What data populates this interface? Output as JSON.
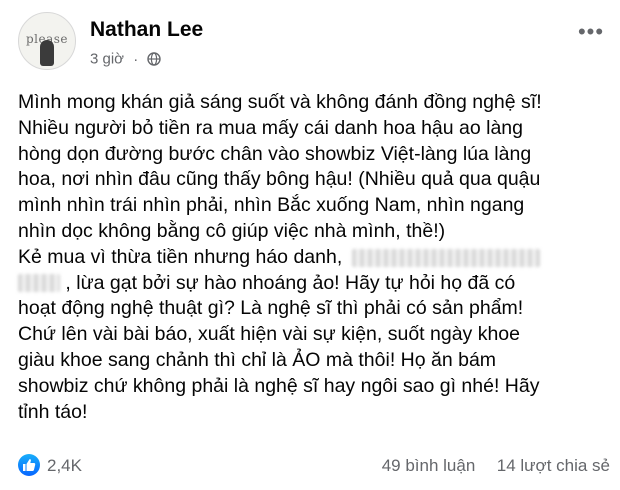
{
  "author": {
    "name": "Nathan Lee",
    "avatar_text": "please"
  },
  "meta": {
    "time": "3 giờ",
    "separator": "·",
    "audience_icon": "globe-icon",
    "more_icon": "more-dots-icon"
  },
  "post": {
    "lines": [
      "Mình mong khán giả sáng suốt và không đánh đồng nghệ sĩ!",
      "Nhiều người bỏ tiền ra mua mấy cái danh hoa hậu ao làng",
      "hòng dọn đường bước chân vào showbiz Việt-làng lúa làng",
      "hoa, nơi nhìn đâu cũng thấy bông hậu! (Nhiều quả qua quậu",
      "mình nhìn trái nhìn phải, nhìn Bắc xuống Nam, nhìn ngang",
      "nhìn dọc không bằng cô giúp việc nhà mình, thề!)",
      "Kẻ mua vì thừa tiền nhưng háo danh,",
      ", lừa gạt bởi sự hào nhoáng ảo! Hãy tự hỏi họ đã có",
      "hoạt động nghệ thuật gì? Là nghệ sĩ thì phải có sản phẩm!",
      "Chứ lên vài bài báo, xuất hiện vài sự kiện, suốt ngày khoe",
      "giàu khoe sang chảnh thì chỉ là ẢO mà thôi! Họ ăn bám",
      "showbiz chứ không phải là nghệ sĩ hay ngôi sao gì nhé! Hãy",
      "tỉnh táo!"
    ]
  },
  "footer": {
    "reaction_icon": "like-icon",
    "reaction_color": "#0866ff",
    "reactions_count": "2,4K",
    "comments": "49 bình luận",
    "shares": "14 lượt chia sẻ"
  }
}
